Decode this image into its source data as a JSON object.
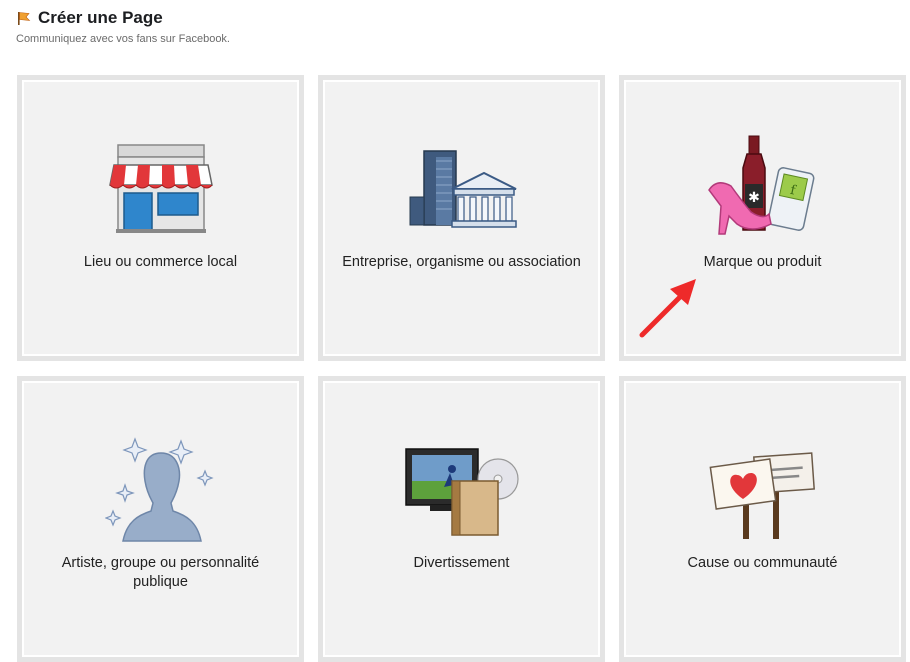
{
  "header": {
    "title": "Créer une Page",
    "subtitle": "Communiquez avec vos fans sur Facebook."
  },
  "tiles": [
    {
      "label": "Lieu ou commerce local",
      "icon": "storefront-icon"
    },
    {
      "label": "Entreprise, organisme ou association",
      "icon": "buildings-icon"
    },
    {
      "label": "Marque ou produit",
      "icon": "products-icon"
    },
    {
      "label": "Artiste, groupe ou personnalité publique",
      "icon": "celebrity-silhouette-icon"
    },
    {
      "label": "Divertissement",
      "icon": "media-icon"
    },
    {
      "label": "Cause ou communauté",
      "icon": "protest-signs-icon"
    }
  ],
  "colors": {
    "accent_arrow": "#ee2a2a",
    "title": "#1c1e21",
    "tile_bg": "#f2f2f2",
    "tile_border": "#e4e4e4"
  }
}
